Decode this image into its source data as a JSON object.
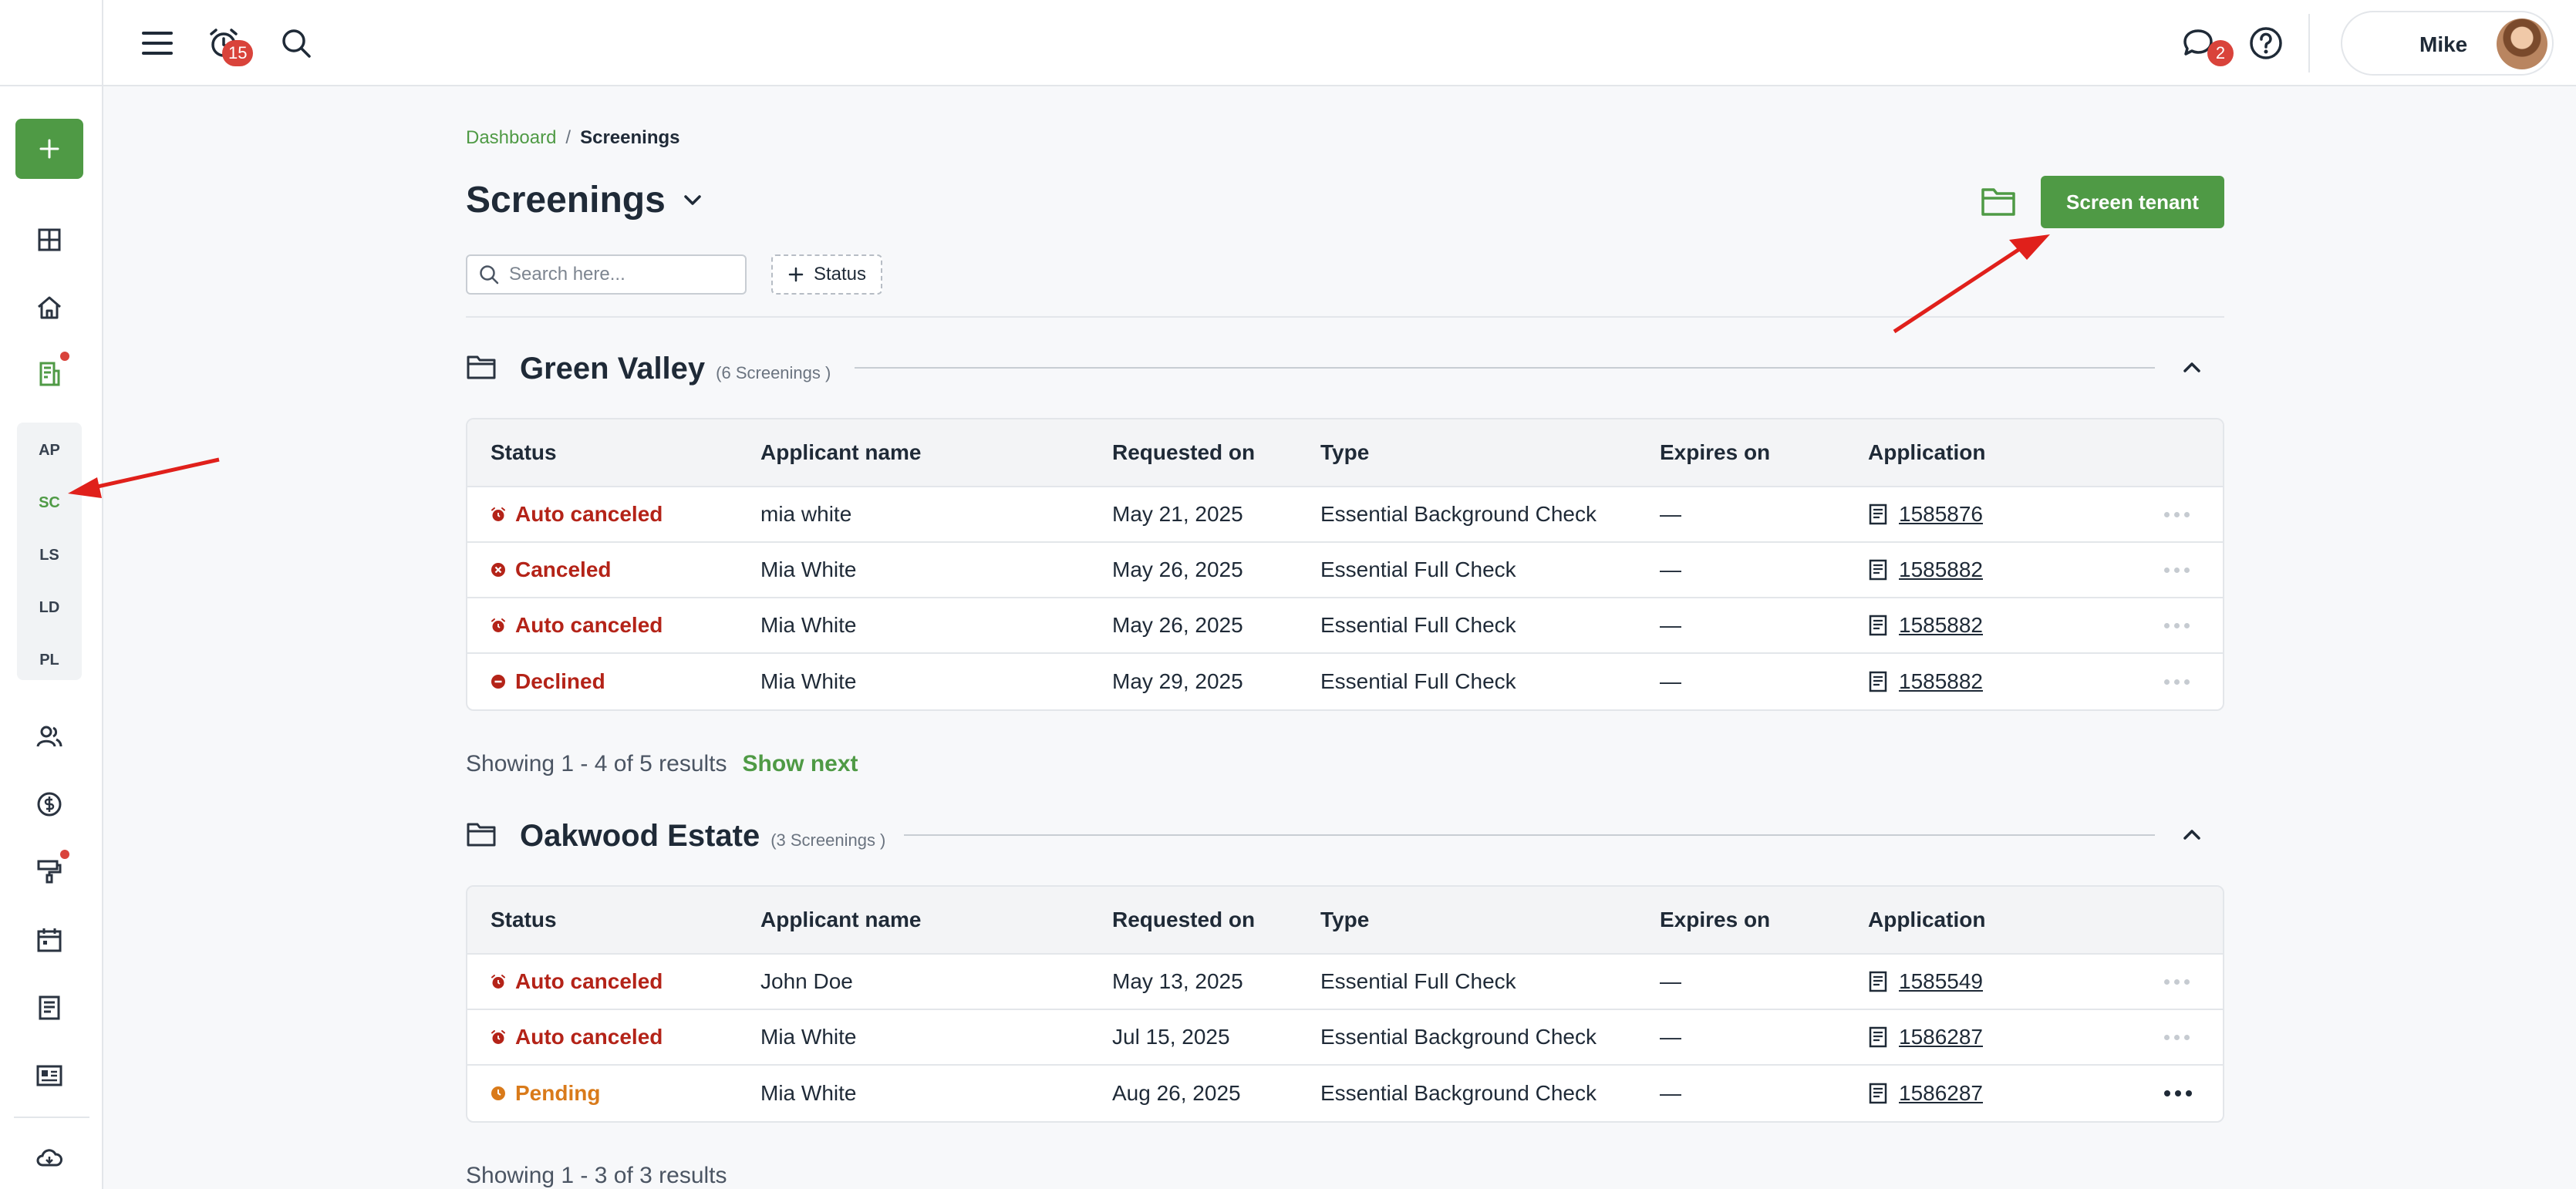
{
  "sidebar": {
    "add_label": "+",
    "nav_icons": [
      "dashboard-icon",
      "home-icon",
      "screening-icon",
      "people-icon",
      "dollar-icon",
      "maintenance-icon",
      "calendar-icon",
      "document-icon",
      "listing-icon",
      "cloud-icon"
    ],
    "sub_items": [
      {
        "label": "AP",
        "active": false
      },
      {
        "label": "SC",
        "active": true
      },
      {
        "label": "LS",
        "active": false
      },
      {
        "label": "LD",
        "active": false
      },
      {
        "label": "PL",
        "active": false
      }
    ]
  },
  "topbar": {
    "notifications_count": "15",
    "messages_count": "2",
    "user_name": "Mike"
  },
  "breadcrumb": {
    "parent": "Dashboard",
    "separator": "/",
    "current": "Screenings"
  },
  "page": {
    "title": "Screenings",
    "primary_button": "Screen tenant",
    "search_placeholder": "Search here...",
    "status_filter": "Status"
  },
  "columns": [
    "Status",
    "Applicant name",
    "Requested on",
    "Type",
    "Expires on",
    "Application"
  ],
  "groups": [
    {
      "name": "Green Valley",
      "count_label": "(6 Screenings )",
      "rows": [
        {
          "status": "Auto canceled",
          "status_kind": "auto",
          "name": "mia white",
          "requested": "May 21, 2025",
          "type": "Essential Background Check",
          "expires": "—",
          "application": "1585876"
        },
        {
          "status": "Canceled",
          "status_kind": "canceled",
          "name": "Mia White",
          "requested": "May 26, 2025",
          "type": "Essential Full Check",
          "expires": "—",
          "application": "1585882"
        },
        {
          "status": "Auto canceled",
          "status_kind": "auto",
          "name": "Mia White",
          "requested": "May 26, 2025",
          "type": "Essential Full Check",
          "expires": "—",
          "application": "1585882"
        },
        {
          "status": "Declined",
          "status_kind": "declined",
          "name": "Mia White",
          "requested": "May 29, 2025",
          "type": "Essential Full Check",
          "expires": "—",
          "application": "1585882"
        }
      ],
      "results_text": "Showing 1 - 4 of 5 results",
      "show_next": "Show next"
    },
    {
      "name": "Oakwood Estate",
      "count_label": "(3 Screenings )",
      "rows": [
        {
          "status": "Auto canceled",
          "status_kind": "auto",
          "name": "John Doe",
          "requested": "May 13, 2025",
          "type": "Essential Full Check",
          "expires": "—",
          "application": "1585549"
        },
        {
          "status": "Auto canceled",
          "status_kind": "auto",
          "name": "Mia White",
          "requested": "Jul 15, 2025",
          "type": "Essential Background Check",
          "expires": "—",
          "application": "1586287"
        },
        {
          "status": "Pending",
          "status_kind": "pending",
          "name": "Mia White",
          "requested": "Aug 26, 2025",
          "type": "Essential Background Check",
          "expires": "—",
          "application": "1586287"
        }
      ],
      "results_text": "Showing 1 - 3 of 3 results"
    }
  ],
  "colors": {
    "brand_green": "#4f9a45",
    "status_red": "#b42318",
    "status_pending": "#d97a1a",
    "annotation_red": "#e0201b"
  }
}
